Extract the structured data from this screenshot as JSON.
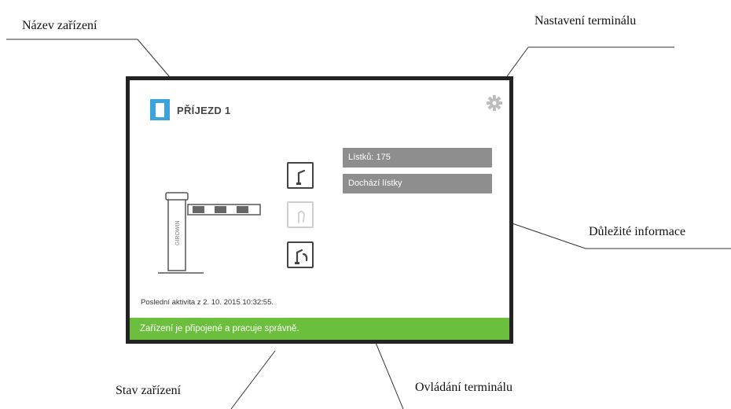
{
  "callouts": {
    "device_name": "Název zařízení",
    "terminal_settings": "Nastavení terminálu",
    "important_info": "Důležité informace",
    "device_status": "Stav zařízení",
    "terminal_control": "Ovládání terminálu"
  },
  "terminal": {
    "name": "PŘÍJEZD 1",
    "info": [
      "Lístků: 175",
      "Dochází lístky"
    ],
    "last_activity": "Poslední aktivita z 2. 10. 2015 10:32:55.",
    "status": "Zařízení je připojené a pracuje správně.",
    "barrier_label": "GIROWIN",
    "colors": {
      "status_ok": "#6cbf3c",
      "info_box": "#8e8e8e",
      "device_icon": "#3aa3e0",
      "frame": "#222222"
    },
    "controls": [
      {
        "icon": "barrier-open-icon",
        "enabled": true
      },
      {
        "icon": "barrier-close-icon",
        "enabled": false
      },
      {
        "icon": "barrier-cycle-icon",
        "enabled": true
      }
    ]
  }
}
